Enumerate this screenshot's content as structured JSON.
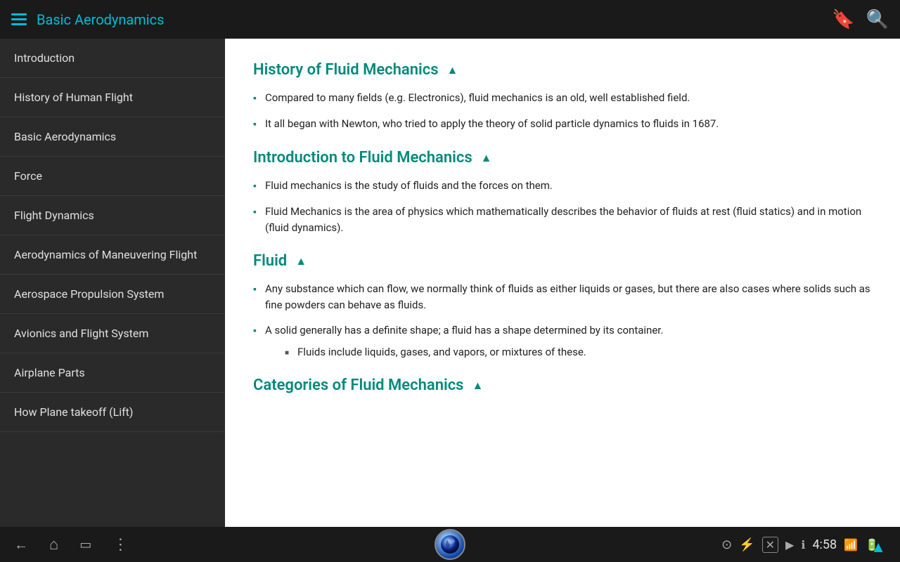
{
  "topbar": {
    "title": "Basic Aerodynamics"
  },
  "sidebar": {
    "items": [
      {
        "label": "Introduction"
      },
      {
        "label": "History of Human Flight"
      },
      {
        "label": "Basic Aerodynamics"
      },
      {
        "label": "Force"
      },
      {
        "label": "Flight Dynamics"
      },
      {
        "label": "Aerodynamics of Maneuvering Flight"
      },
      {
        "label": "Aerospace Propulsion System"
      },
      {
        "label": "Avionics and Flight System"
      },
      {
        "label": "Airplane Parts"
      },
      {
        "label": "How Plane takeoff (Lift)"
      }
    ]
  },
  "content": {
    "sections": [
      {
        "id": "history-fluid",
        "title": "History of Fluid Mechanics",
        "bullets": [
          {
            "text": "Compared to many fields (e.g. Electronics), fluid mechanics is an old, well established field.",
            "sub": []
          },
          {
            "text": "It all began with Newton, who tried to apply the theory of solid particle dynamics to fluids in 1687.",
            "sub": []
          }
        ]
      },
      {
        "id": "intro-fluid",
        "title": "Introduction to Fluid Mechanics",
        "bullets": [
          {
            "text": "Fluid mechanics is the study of fluids and the forces on them.",
            "sub": []
          },
          {
            "text": "Fluid Mechanics is the area of physics which mathematically describes the behavior of fluids at rest (fluid statics) and in motion (fluid dynamics).",
            "sub": []
          }
        ]
      },
      {
        "id": "fluid",
        "title": "Fluid",
        "bullets": [
          {
            "text": "Any substance which can flow, we normally think of fluids as either liquids or gases, but there are also cases where solids such as fine powders can behave as fluids.",
            "sub": []
          },
          {
            "text": "A solid generally has a definite shape; a fluid has a shape determined by its container.",
            "sub": [
              "Fluids include liquids, gases, and vapors, or mixtures of these."
            ]
          }
        ]
      },
      {
        "id": "categories-fluid",
        "title": "Categories of Fluid Mechanics",
        "bullets": []
      }
    ]
  },
  "bottombar": {
    "time": "4:58",
    "nav": {
      "back": "←",
      "home": "⌂",
      "recents": "▭",
      "menu": "⋮"
    }
  }
}
